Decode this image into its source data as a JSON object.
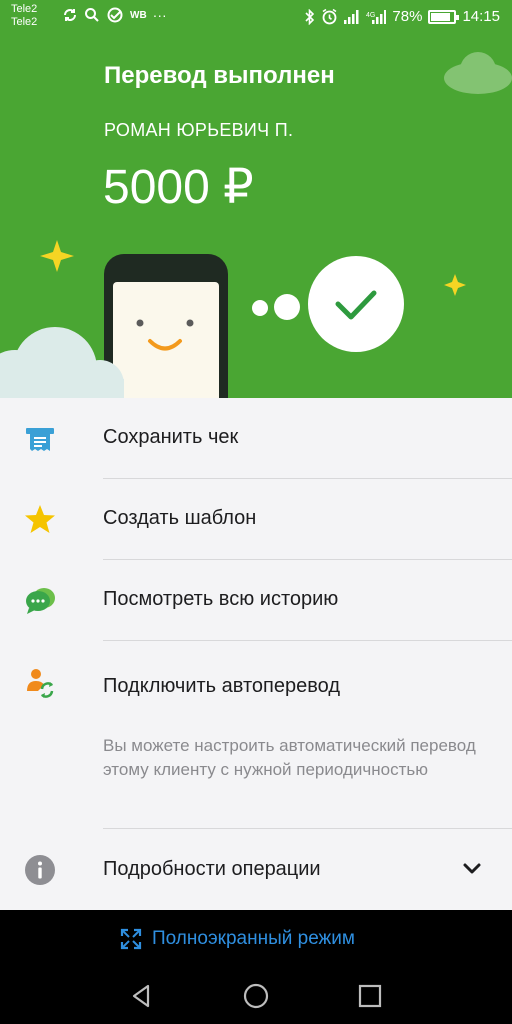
{
  "status_bar": {
    "carrier_1": "Tele2",
    "carrier_2": "Tele2",
    "wb_label": "WB",
    "dots": "···",
    "battery_percent": "78%",
    "battery_level": 0.78,
    "time": "14:15"
  },
  "hero": {
    "title": "Перевод выполнен",
    "recipient": "РОМАН ЮРЬЕВИЧ П.",
    "amount": "5000 ₽"
  },
  "actions": [
    {
      "label": "Сохранить чек",
      "icon": "receipt-icon",
      "color": "#3aa0d6"
    },
    {
      "label": "Создать шаблон",
      "icon": "star-icon",
      "color": "#f5c400"
    },
    {
      "label": "Посмотреть всю историю",
      "icon": "chat-icon",
      "color": "#3aa64a"
    },
    {
      "label": "Подключить автоперевод",
      "icon": "auto-transfer-icon",
      "color": "#f08a1c",
      "description": "Вы можете настроить автоматический перевод этому клиенту с нужной периодичностью"
    },
    {
      "label": "Подробности операции",
      "icon": "info-icon",
      "color": "#8e8e93"
    }
  ],
  "fullscreen": {
    "label": "Полноэкранный режим",
    "color": "#2f8fe0"
  },
  "colors": {
    "brand_green": "#4aa633",
    "background": "#f4f4f6"
  }
}
